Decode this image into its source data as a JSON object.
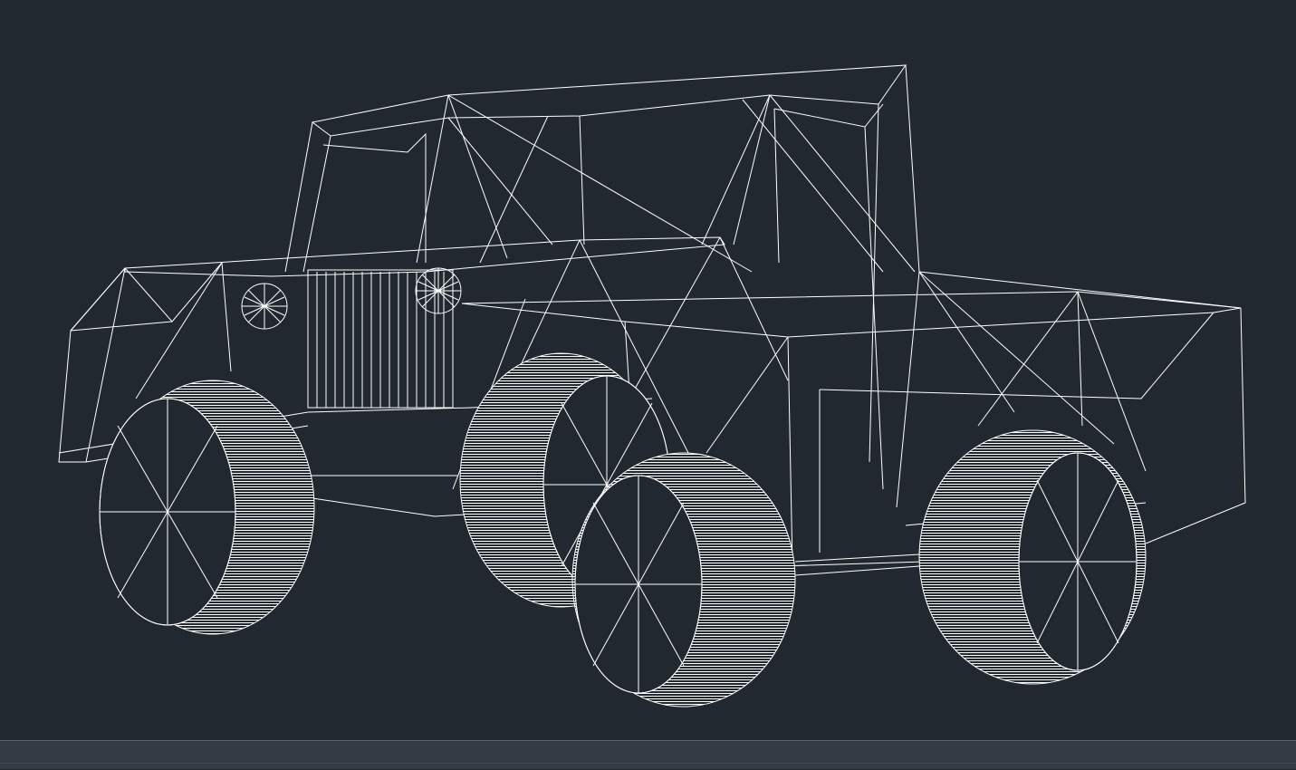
{
  "viewport": {
    "background": "#212830",
    "line_color": "#ffffff",
    "visual_style": "wireframe",
    "model": "monster-truck-wireframe"
  },
  "status_bar": {
    "background": "#333b45",
    "icons": [
      "command-prompt-icon"
    ]
  }
}
